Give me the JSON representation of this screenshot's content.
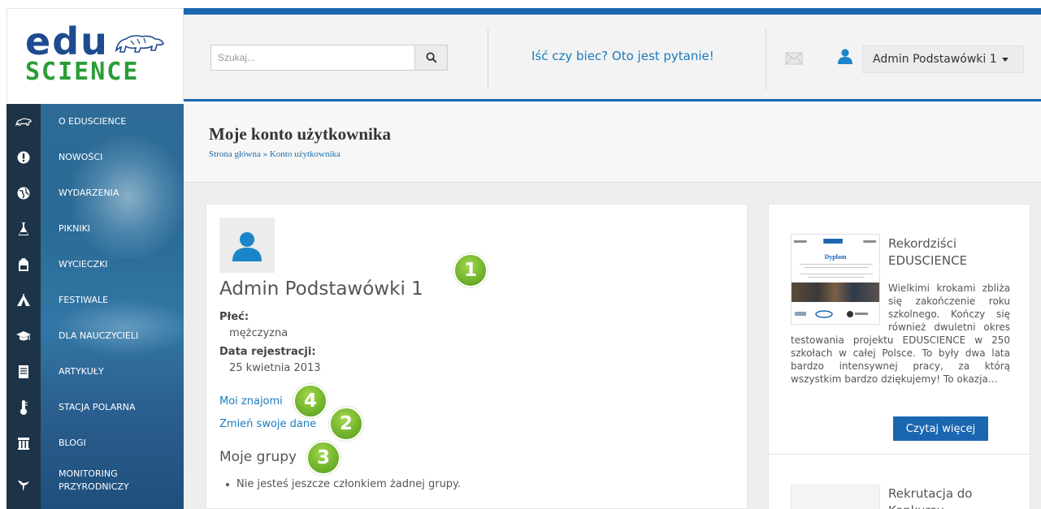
{
  "brand": {
    "logo_top": "edu",
    "logo_bottom": "SCIENCE",
    "colors": {
      "primary": "#1b66b0",
      "logo_blue": "#1e4b8f",
      "logo_green": "#2a9d36",
      "badge_green": "#6fb22b",
      "link": "#1a7bbf"
    }
  },
  "header": {
    "search_placeholder": "Szukaj...",
    "search_icon": "search-icon",
    "promo_link": "Iść czy biec? Oto jest pytanie!",
    "mail_icon": "envelope-icon",
    "user_icon": "user-icon",
    "user_menu_label": "Admin Podstawówki 1"
  },
  "sidebar": {
    "items": [
      {
        "label": "O EDUSCIENCE",
        "icon": "polar-bear-icon"
      },
      {
        "label": "NOWOŚCI",
        "icon": "exclamation-icon"
      },
      {
        "label": "WYDARZENIA",
        "icon": "globe-icon"
      },
      {
        "label": "PIKNIKI",
        "icon": "flask-icon"
      },
      {
        "label": "WYCIECZKI",
        "icon": "backpack-icon"
      },
      {
        "label": "FESTIWALE",
        "icon": "tent-icon"
      },
      {
        "label": "DLA NAUCZYCIELI",
        "icon": "graduation-cap-icon"
      },
      {
        "label": "ARTYKUŁY",
        "icon": "document-icon"
      },
      {
        "label": "STACJA POLARNA",
        "icon": "thermometer-icon"
      },
      {
        "label": "BLOGI",
        "icon": "columns-icon"
      },
      {
        "label": "MONITORING PRZYRODNICZY",
        "icon": "bird-icon"
      }
    ]
  },
  "page": {
    "title": "Moje konto użytkownika",
    "breadcrumb": "Strona główna » Konto użytkownika"
  },
  "profile": {
    "name": "Admin Podstawówki 1",
    "gender_label": "Płeć:",
    "gender_value": "mężczyzna",
    "registration_label": "Data rejestracji:",
    "registration_value": "25 kwietnia 2013",
    "friends_link": "Moi znajomi",
    "edit_link": "Zmień swoje dane",
    "groups_title": "Moje grupy",
    "groups_empty": "Nie jesteś jeszcze członkiem żadnej grupy.",
    "badges": {
      "name": "1",
      "edit": "2",
      "groups": "3",
      "friends": "4"
    }
  },
  "news": [
    {
      "title": "Rekordziści EDUSCIENCE",
      "thumb_title": "Dyplom",
      "excerpt": "Wielkimi krokami zbliża się zakończenie roku szkolnego. Kończy się również dwuletni okres testowania projektu EDUSCIENCE w 250 szkołach w całej Polsce. To były dwa lata bardzo intensywnej pracy, za którą wszystkim bardzo dziękujemy! To okazja…",
      "button": "Czytaj więcej"
    },
    {
      "title": "Rekrutacja do Konkursu"
    }
  ]
}
